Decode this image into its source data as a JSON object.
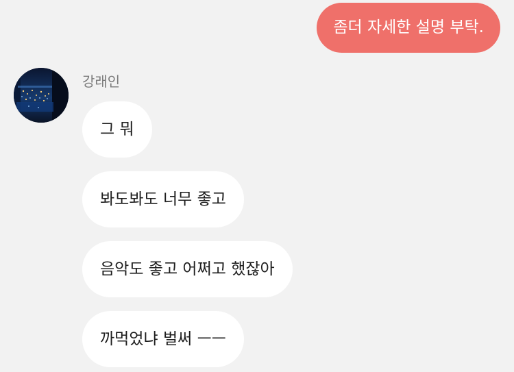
{
  "conversation": {
    "outgoing": [
      {
        "text": "좀더 자세한 설명 부탁."
      }
    ],
    "incoming": {
      "sender_name": "강래인",
      "avatar_icon": "night-city-photo",
      "messages": [
        {
          "text": "그 뭐"
        },
        {
          "text": "봐도봐도 너무 좋고"
        },
        {
          "text": "음악도 좋고 어쩌고 했잖아"
        },
        {
          "text": "까먹었냐 벌써 ㅡㅡ"
        }
      ]
    }
  },
  "colors": {
    "background": "#f2f2f2",
    "outgoing_bubble": "#ef706a",
    "outgoing_text": "#ffffff",
    "incoming_bubble": "#ffffff",
    "incoming_text": "#1e1e1e",
    "sender_name": "#7a7a7a"
  }
}
